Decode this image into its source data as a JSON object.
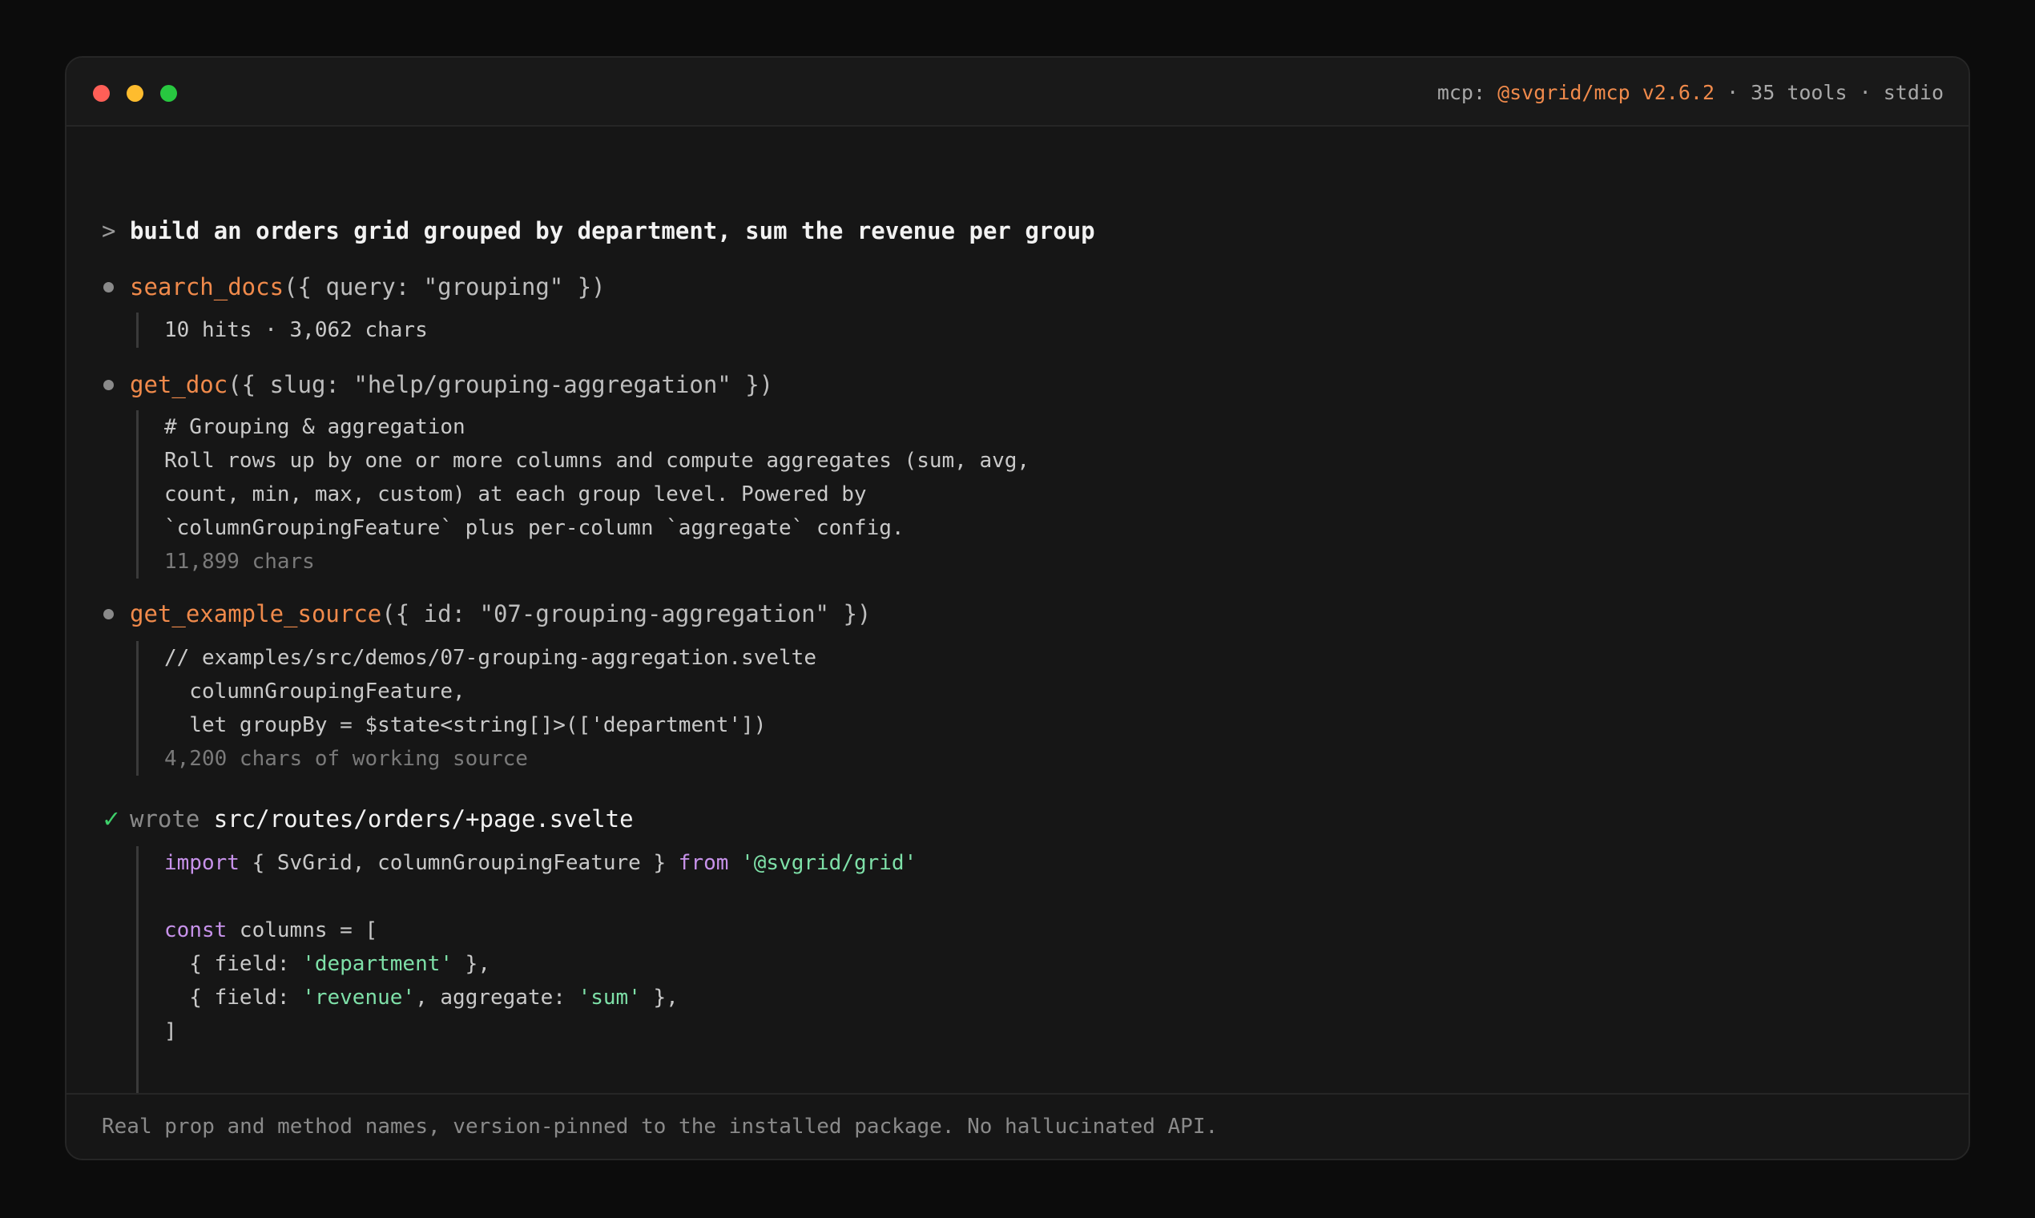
{
  "window": {
    "controls": [
      "close",
      "minimize",
      "zoom"
    ],
    "status": {
      "prefix": "mcp: ",
      "package": "@svgrid/mcp v2.6.2",
      "suffix": " · 35 tools · stdio"
    }
  },
  "prompt": {
    "caret": ">",
    "text": "build an orders grid grouped by department, sum the revenue per group"
  },
  "steps": [
    {
      "fn": "search_docs",
      "args": "({ query: \"grouping\" })",
      "result": [
        "10 hits · 3,062 chars"
      ]
    },
    {
      "fn": "get_doc",
      "args": "({ slug: \"help/grouping-aggregation\" })",
      "result": [
        "# Grouping & aggregation",
        "Roll rows up by one or more columns and compute aggregates (sum, avg,",
        "count, min, max, custom) at each group level. Powered by",
        "`columnGroupingFeature` plus per-column `aggregate` config."
      ],
      "meta": "11,899 chars"
    },
    {
      "fn": "get_example_source",
      "args": "({ id: \"07-grouping-aggregation\" })",
      "result": [
        "// examples/src/demos/07-grouping-aggregation.svelte",
        "  columnGroupingFeature,",
        "  let groupBy = $state<string[]>(['department'])"
      ],
      "meta": "4,200 chars of working source"
    }
  ],
  "wrote": {
    "check": "✓",
    "label": "wrote",
    "path": "src/routes/orders/+page.svelte",
    "code": {
      "import_kw": "import",
      "import_names": " { SvGrid, columnGroupingFeature } ",
      "from_kw": "from",
      "import_src": "'@svgrid/grid'",
      "const_kw": "const",
      "const_rest": " columns = [",
      "row1_a": "  { field: ",
      "row1_str": "'department'",
      "row1_b": " },",
      "row2_a": "  { field: ",
      "row2_str1": "'revenue'",
      "row2_b": ", aggregate: ",
      "row2_str2": "'sum'",
      "row2_c": " },",
      "close": "]"
    }
  },
  "footer": {
    "text": "Real prop and method names, version-pinned to the installed package. No hallucinated API."
  },
  "colors": {
    "background": "#0c0c0c",
    "window": "#161616",
    "accent": "#f08a4b",
    "success": "#3ecf6a",
    "keyword": "#c792ea",
    "string": "#7ee0a8"
  }
}
